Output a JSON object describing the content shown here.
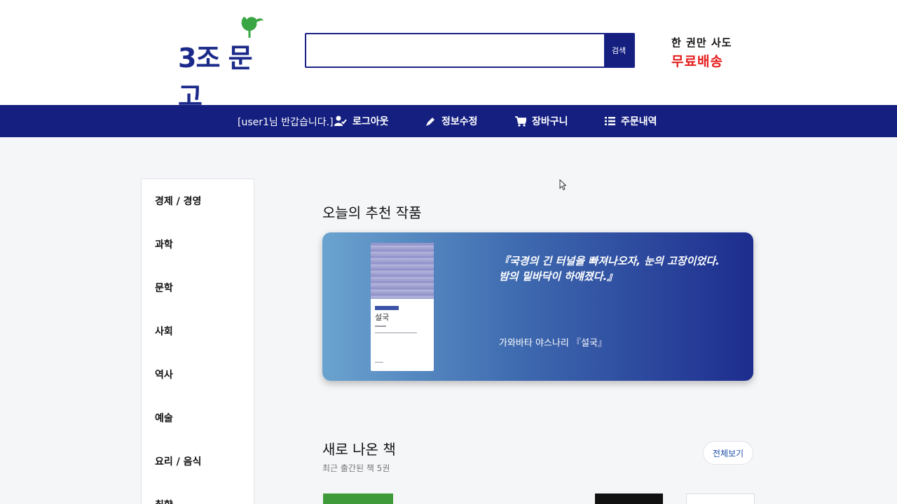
{
  "header": {
    "logo_text": "3조 문고",
    "search": {
      "value": "",
      "button_label": "검색"
    },
    "promo": {
      "line1": "한 권만 사도",
      "line2": "무료배송"
    }
  },
  "nav": {
    "greeting": "[user1님 반갑습니다.]",
    "items": [
      {
        "label": "로그아웃",
        "icon": "user-check-icon"
      },
      {
        "label": "정보수정",
        "icon": "pencil-icon"
      },
      {
        "label": "장바구니",
        "icon": "cart-icon"
      },
      {
        "label": "주문내역",
        "icon": "list-icon"
      }
    ]
  },
  "sidebar": {
    "categories": [
      "경제 / 경영",
      "과학",
      "문학",
      "사회",
      "역사",
      "예술",
      "요리 / 음식",
      "취향"
    ]
  },
  "recommend": {
    "title": "오늘의 추천 작품",
    "book_cover_title": "설국",
    "quote_line1": "『국경의 긴 터널을 빠져나오자, 눈의 고장이었다.",
    "quote_line2": "밤의 밑바닥이 하얘졌다.』",
    "author": "가와바타 야스나리 『설국』"
  },
  "new_books": {
    "title": "새로 나온 책",
    "subtitle": "최근 출간된 책 5권",
    "view_all": "전체보기"
  },
  "colors": {
    "brand_navy": "#141f80",
    "promo_red": "#e51b1b",
    "leaf_green": "#3aa543"
  }
}
